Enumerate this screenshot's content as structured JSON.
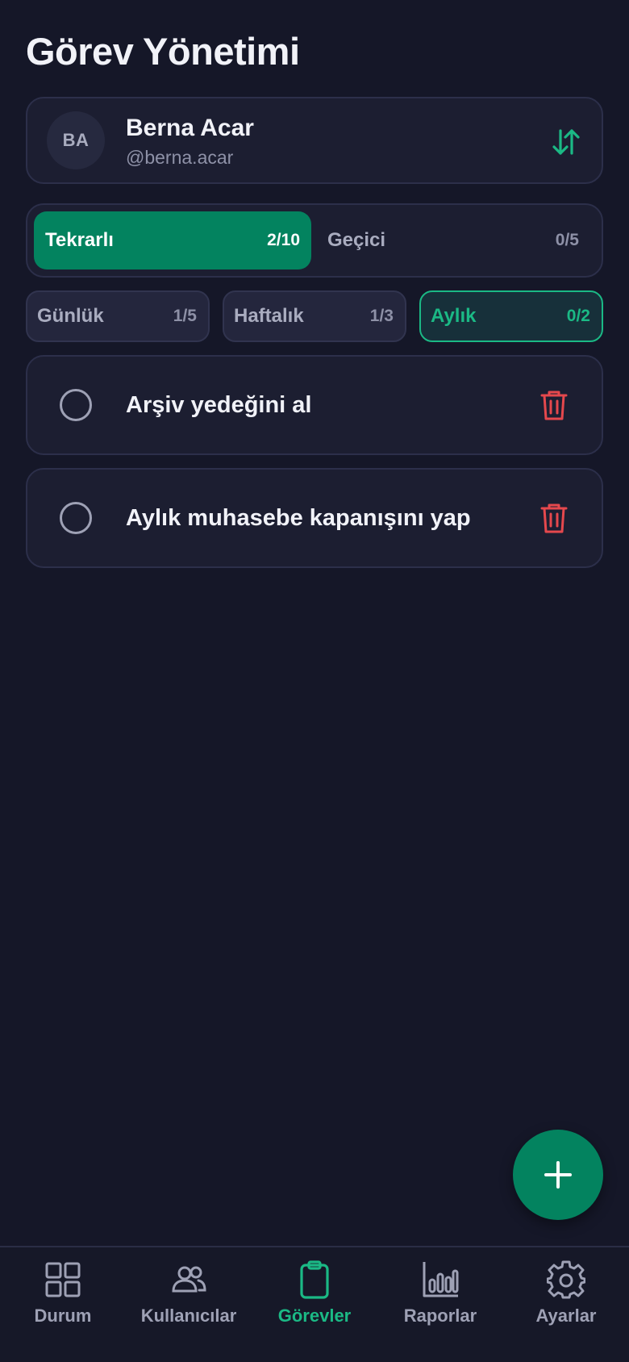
{
  "page": {
    "title": "Görev Yönetimi"
  },
  "user": {
    "initials": "BA",
    "name": "Berna Acar",
    "handle": "@berna.acar",
    "switch_icon": "swap-vertical-icon"
  },
  "type_tabs": [
    {
      "label": "Tekrarlı",
      "count": "2/10",
      "selected": true
    },
    {
      "label": "Geçici",
      "count": "0/5",
      "selected": false
    }
  ],
  "period_filters": [
    {
      "label": "Günlük",
      "count": "1/5",
      "selected": false
    },
    {
      "label": "Haftalık",
      "count": "1/3",
      "selected": false
    },
    {
      "label": "Aylık",
      "count": "0/2",
      "selected": true
    }
  ],
  "tasks": [
    {
      "title": "Arşiv yedeğini al",
      "completed": false,
      "delete_icon": "trash-icon"
    },
    {
      "title": "Aylık muhasebe kapanışını yap",
      "completed": false,
      "delete_icon": "trash-icon"
    }
  ],
  "fab": {
    "icon": "plus-icon"
  },
  "bottom_nav": [
    {
      "label": "Durum",
      "icon": "grid-icon",
      "active": false
    },
    {
      "label": "Kullanıcılar",
      "icon": "users-icon",
      "active": false
    },
    {
      "label": "Görevler",
      "icon": "clipboard-icon",
      "active": true
    },
    {
      "label": "Raporlar",
      "icon": "bar-chart-icon",
      "active": false
    },
    {
      "label": "Ayarlar",
      "icon": "gear-icon",
      "active": false
    }
  ],
  "colors": {
    "background": "#151728",
    "card": "#1c1e31",
    "accent": "#03835f",
    "accent_text": "#1bb985",
    "danger": "#e5484d"
  }
}
